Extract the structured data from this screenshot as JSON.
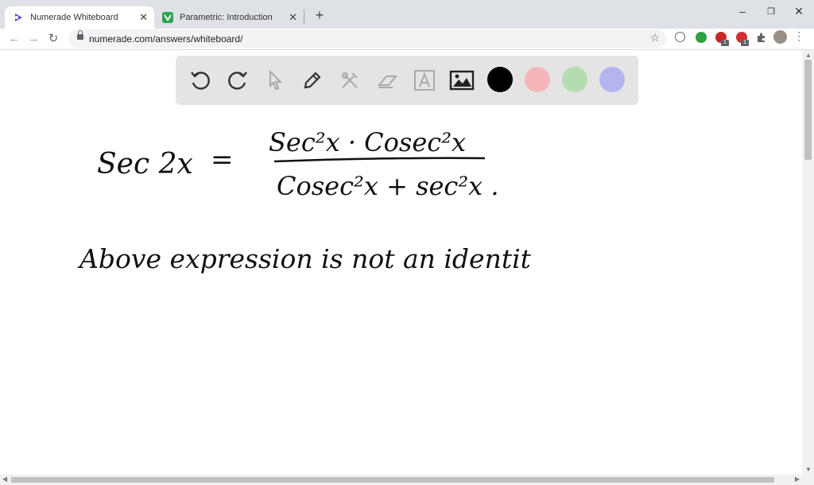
{
  "browser": {
    "tabs": [
      {
        "title": "Numerade Whiteboard",
        "active": true
      },
      {
        "title": "Parametric: Introduction",
        "active": false
      }
    ],
    "url": "numerade.com/answers/whiteboard/",
    "extension_badges": [
      "1",
      "1"
    ]
  },
  "whiteboard": {
    "tools": [
      "undo-icon",
      "redo-icon",
      "pointer-icon",
      "pen-icon",
      "tools-icon",
      "eraser-icon",
      "text-icon",
      "image-icon"
    ],
    "colors": [
      "#000000",
      "#f4b6b8",
      "#b5dcb0",
      "#b6b4ef"
    ],
    "equation": {
      "lhs": "Sec 2x",
      "eq": "=",
      "numerator": "Sec²x · Cosec²x",
      "denominator": "Cosec²x + sec²x ."
    },
    "note": "Above expression is not an identit"
  }
}
